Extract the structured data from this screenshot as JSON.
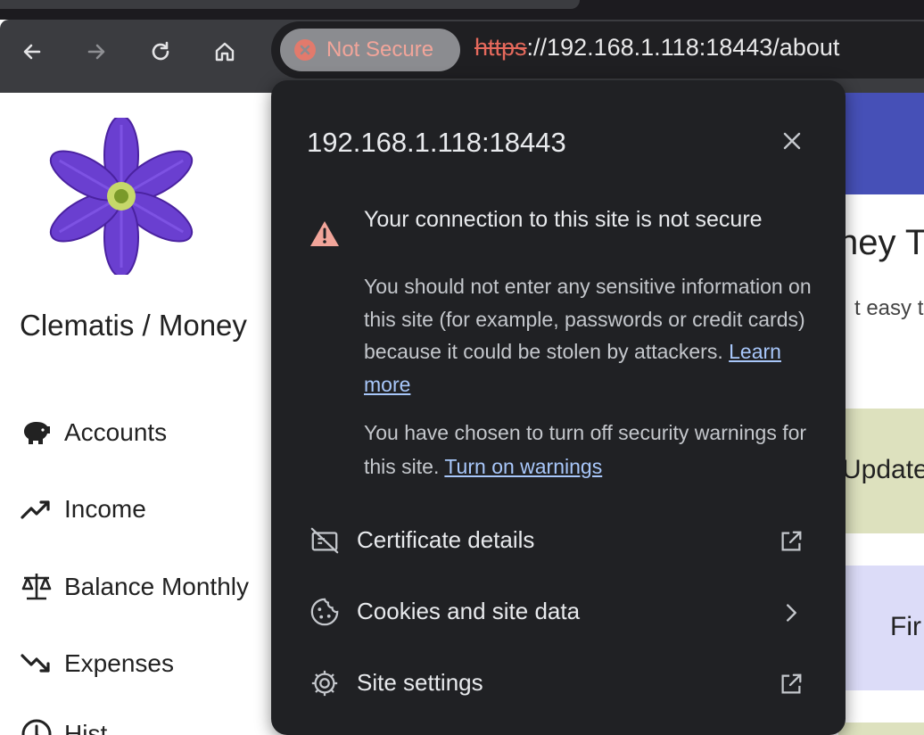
{
  "browser": {
    "security_chip": {
      "label": "Not Secure",
      "icon": "x-circle-icon",
      "color": "#e27a6c"
    },
    "url": {
      "scheme": "https",
      "rest": "://192.168.1.118:18443/about"
    },
    "nav_icons": [
      "back-arrow-icon",
      "forward-arrow-icon",
      "reload-icon",
      "home-icon"
    ]
  },
  "popup": {
    "host": "192.168.1.118:18443",
    "warning_title": "Your connection to this site is not secure",
    "warning_body": "You should not enter any sensitive information on this site (for example, passwords or credit cards) because it could be stolen by attackers.",
    "learn_more": "Learn more",
    "chosen_text": "You have chosen to turn off security warnings for this site.",
    "turn_on_warnings": "Turn on warnings",
    "items": [
      {
        "label": "Certificate details",
        "icon": "certificate-off-icon",
        "trailing": "external-link-icon"
      },
      {
        "label": "Cookies and site data",
        "icon": "cookie-icon",
        "trailing": "chevron-right-icon"
      },
      {
        "label": "Site settings",
        "icon": "gear-icon",
        "trailing": "external-link-icon"
      }
    ]
  },
  "page": {
    "app_title": "Clematis / Money",
    "nav": [
      {
        "label": "Accounts",
        "icon": "piggy-bank-icon"
      },
      {
        "label": "Income",
        "icon": "trending-up-icon"
      },
      {
        "label": "Balance Monthly",
        "icon": "scale-icon"
      },
      {
        "label": "Expenses",
        "icon": "trending-down-icon"
      },
      {
        "label": "Hist",
        "icon": "clock-icon"
      }
    ],
    "heading_fragment": "ney T",
    "subtitle_fragment": "t easy to",
    "card1_fragment": "Update",
    "card2_fragment": "Fir"
  },
  "colors": {
    "toolbar": "#3b3c40",
    "popup_bg": "#202124",
    "link": "#a8c7fa",
    "header_blue": "#4650b7",
    "card_green": "#dde1be",
    "card_lavender": "#dcdcf8"
  }
}
